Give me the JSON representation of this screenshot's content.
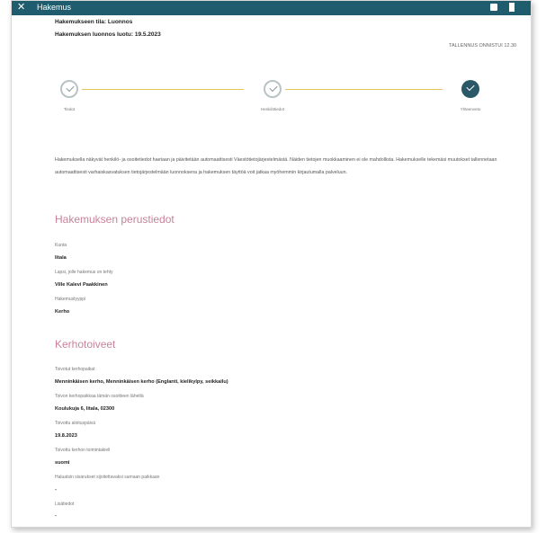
{
  "header": {
    "title": "Hakemus",
    "close_icon": "close-icon",
    "print_icon": "print-icon",
    "document_icon": "document-icon",
    "color": "#1f5d6e"
  },
  "status": {
    "state": "Hakemukseen tila: Luonnos",
    "created": "Hakemuksen luonnos luotu: 19.5.2023",
    "saved": "TALLENNUS ONNISTUI 12.30"
  },
  "stepper": {
    "steps": [
      "Tiedot",
      "Henkilötiedot",
      "Yhteenveto"
    ],
    "done_color": "#b9c3c6",
    "active_color": "#2b5866",
    "line_color": "#e5c65a"
  },
  "intro": "Hakemuksella näkyvät henkilö- ja osoitetiedot haetaan ja päivitetään automaattisesti Väestötietojärjestelmästä. Näiden tietojen muokkaaminen ei ole mahdollista. Hakemukselle tekemäsi muutokset tallennetaan automaattisesti varhaiskasvatuksen tietojärjestelmään luonnoksena ja hakemuksen täyttöä voit jatkaa myöhemmin kirjautumalla palveluun.",
  "basic": {
    "title": "Hakemuksen perustiedot",
    "fields": [
      {
        "label": "Kunta",
        "value": "Iitala"
      },
      {
        "label": "Lapsi, jolle hakemus on tehty",
        "value": "Ville Kalevi Paakkinen"
      },
      {
        "label": "Hakemustyyppi",
        "value": "Kerho"
      }
    ]
  },
  "wishes": {
    "title": "Kerhotoiveet",
    "fields": [
      {
        "label": "Toivotut kerhopaikat",
        "value": "Menninkäisen kerho, Menninkäisen kerho (Englanti, kielikylpy, seikkailu)"
      },
      {
        "label": "Toivon kerhopaikkaa tämän osoitteen läheltä",
        "value": "Koulukuja 6, Iitala, 02300"
      },
      {
        "label": "Toivottu aloituspäivä",
        "value": "19.8.2023"
      },
      {
        "label": "Toivottu kerhon toimintakieli",
        "value": "suomi"
      },
      {
        "label": "Haluatsin sisarukset sijoitettavaksi samaan paikkaan",
        "value": "-"
      },
      {
        "label": "Lisätiedot",
        "value": "-"
      }
    ]
  }
}
